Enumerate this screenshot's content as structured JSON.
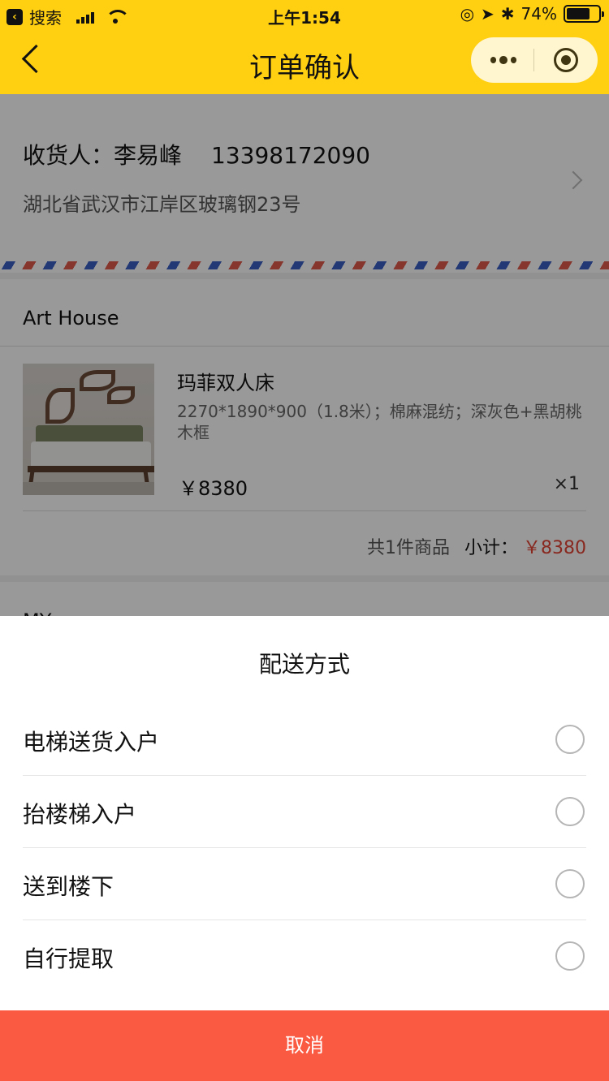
{
  "status_bar": {
    "back_app": "搜索",
    "time": "上午1:54",
    "battery_percent": "74%",
    "battery_level": 0.74
  },
  "nav": {
    "title": "订单确认"
  },
  "address": {
    "receiver_label": "收货人：李易峰",
    "phone": "13398172090",
    "address": "湖北省武汉市江岸区玻璃钢23号"
  },
  "shop": {
    "name": "Art House",
    "product": {
      "title": "玛菲双人床",
      "spec": "2270*1890*900（1.8米）；棉麻混纺；深灰色+黑胡桃木框",
      "price": "￥8380",
      "qty": "×1"
    },
    "summary": {
      "count": "共1件商品",
      "subtotal_label": "小计：",
      "subtotal_value": "￥8380"
    }
  },
  "next_section_peek": "MY",
  "sheet": {
    "title": "配送方式",
    "options": [
      {
        "label": "电梯送货入户"
      },
      {
        "label": "抬楼梯入户"
      },
      {
        "label": "送到楼下"
      },
      {
        "label": "自行提取"
      }
    ],
    "cancel_label": "取消"
  },
  "colors": {
    "header_yellow": "#FFCF11",
    "cancel_red": "#FA5A42",
    "price_red": "#E34435"
  }
}
